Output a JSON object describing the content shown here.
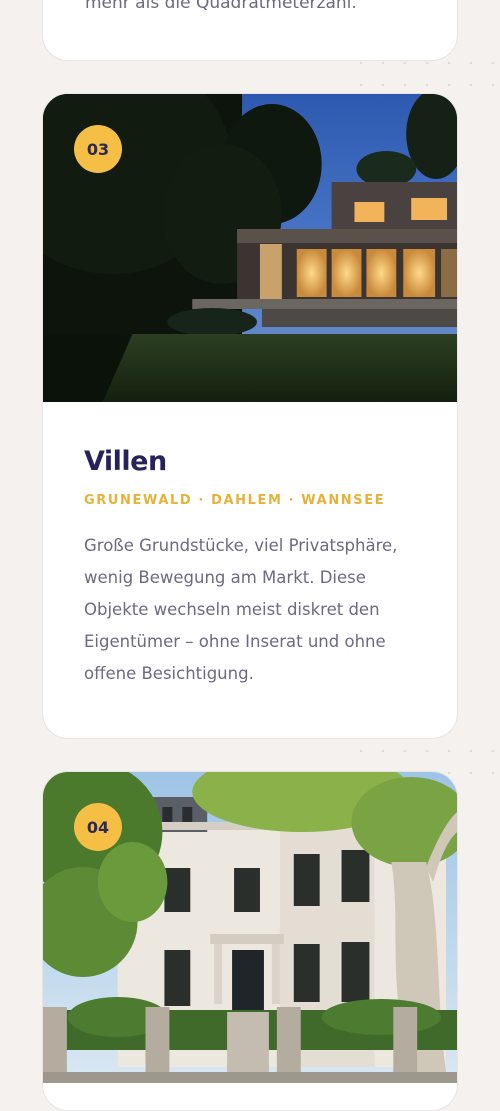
{
  "prev_card": {
    "text_tail": "mehr als die Quadratmeterzahl."
  },
  "cards": [
    {
      "number": "03",
      "title": "Villen",
      "locations": "GRUNEWALD · DAHLEM · WANNSEE",
      "description": "Große Grundstücke, viel Privatsphäre, wenig Bewegung am Markt. Diese Objekte wechseln meist diskret den Eigentümer – ohne Inserat und ohne offene Besichtigung."
    },
    {
      "number": "04"
    }
  ],
  "colors": {
    "page_background": "#f5f1ef",
    "card_background": "#ffffff",
    "badge": "#f5bf45",
    "title": "#27225a",
    "accent": "#e6b23a",
    "body_text": "#6c6a80"
  }
}
